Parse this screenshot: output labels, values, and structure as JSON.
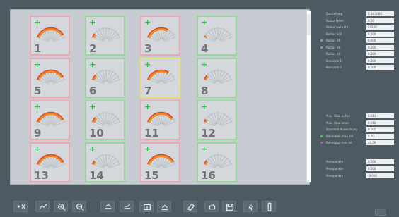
{
  "tiles": [
    {
      "number": "1",
      "border": "pink",
      "level": 0.92
    },
    {
      "number": "2",
      "border": "green",
      "level": 0.12
    },
    {
      "number": "3",
      "border": "pink",
      "level": 0.7
    },
    {
      "number": "4",
      "border": "green",
      "level": 0.05
    },
    {
      "number": "5",
      "border": "pink",
      "level": 0.92
    },
    {
      "number": "6",
      "border": "green",
      "level": 0.15
    },
    {
      "number": "7",
      "border": "yellow",
      "level": 0.72
    },
    {
      "number": "8",
      "border": "green",
      "level": 0.14
    },
    {
      "number": "9",
      "border": "pink",
      "level": 0.93
    },
    {
      "number": "10",
      "border": "green",
      "level": 0.15
    },
    {
      "number": "11",
      "border": "pink",
      "level": 0.88
    },
    {
      "number": "12",
      "border": "green",
      "level": 0.08
    },
    {
      "number": "13",
      "border": "pink",
      "level": 0.94
    },
    {
      "number": "14",
      "border": "green",
      "level": 0.1
    },
    {
      "number": "15",
      "border": "pink",
      "level": 0.92
    },
    {
      "number": "16",
      "border": "green",
      "level": 0.12
    }
  ],
  "tile_plus_symbol": "+",
  "parameters_top": [
    {
      "label": "Darstellung",
      "value": "0,1s,1000"
    },
    {
      "label": "Status Nenn",
      "value": "0,00"
    },
    {
      "label": "Status Auswahl",
      "value": "20500"
    },
    {
      "label": "Radius Soll",
      "value": "0,000"
    },
    {
      "label": "Radius Ist",
      "value": "0,000",
      "marker": "#8fa0a8"
    },
    {
      "label": "Radius Ist",
      "value": "0,000",
      "marker": "#8fa0a8"
    },
    {
      "label": "Radius Ist",
      "value": "0,000"
    },
    {
      "label": "Kennzahl 1",
      "value": "0,000"
    },
    {
      "label": "Kennzahl 2",
      "value": "0,000"
    }
  ],
  "parameters_middle": [
    {
      "label": "Max. Abw. außen",
      "value": "0,011"
    },
    {
      "label": "Max. Abw. innen",
      "value": "0,010"
    },
    {
      "label": "Standard Abweichung",
      "value": "0,005"
    },
    {
      "label": "Rohrdaten max. Ist",
      "value": "0,70",
      "marker": "#39d25a"
    },
    {
      "label": "Rohrdaten min. Ist",
      "value": "40,36",
      "marker": "#e0509a"
    }
  ],
  "parameters_bottom": [
    {
      "label": "Messpunkte",
      "value": "0,000"
    },
    {
      "label": "Messpunkte",
      "value": "0,000"
    },
    {
      "label": "Messpunkte",
      "value": "-0,000"
    }
  ],
  "colors": {
    "panel_bg": "#c6ccd1",
    "app_bg": "#4d5a62",
    "border_pink": "#e9a8b3",
    "border_green": "#9ad59e",
    "border_yellow": "#e6e07a",
    "gauge_red": "#e0412f",
    "gauge_orange": "#f08a22"
  },
  "toolbar_icons": [
    "scale-icon",
    "chart-icon",
    "zoom-in-icon",
    "zoom-out-icon",
    "rotate-left-icon",
    "rotate-right-icon",
    "rotate-up-icon",
    "rotate-down-icon",
    "eraser-icon",
    "print-icon",
    "save-icon",
    "run-icon",
    "battery-icon"
  ]
}
